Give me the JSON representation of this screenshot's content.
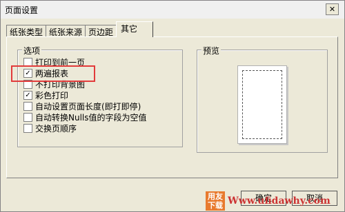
{
  "window": {
    "title": "页面设置",
    "close_label": "✕"
  },
  "tabs": [
    {
      "label": "纸张类型"
    },
    {
      "label": "纸张来源"
    },
    {
      "label": "页边距"
    },
    {
      "label": "其它"
    }
  ],
  "options_group": {
    "label": "选项",
    "items": [
      {
        "label": "打印到前一页",
        "checked": false
      },
      {
        "label": "两遍报表",
        "checked": true
      },
      {
        "label": "不打印背景图",
        "checked": false
      },
      {
        "label": "彩色打印",
        "checked": true
      },
      {
        "label": "自动设置页面长度(即打即停)",
        "checked": false
      },
      {
        "label": "自动转换Nulls值的字段为空值",
        "checked": false
      },
      {
        "label": "交换页顺序",
        "checked": false
      }
    ]
  },
  "preview_group": {
    "label": "预览"
  },
  "buttons": {
    "ok": "确定",
    "cancel": "取消"
  },
  "watermark": {
    "logo": "用友下载",
    "text": "Www.ufidawhy.com"
  },
  "colors": {
    "highlight": "#e23a3a",
    "dialog_bg": "#ece9d8"
  }
}
